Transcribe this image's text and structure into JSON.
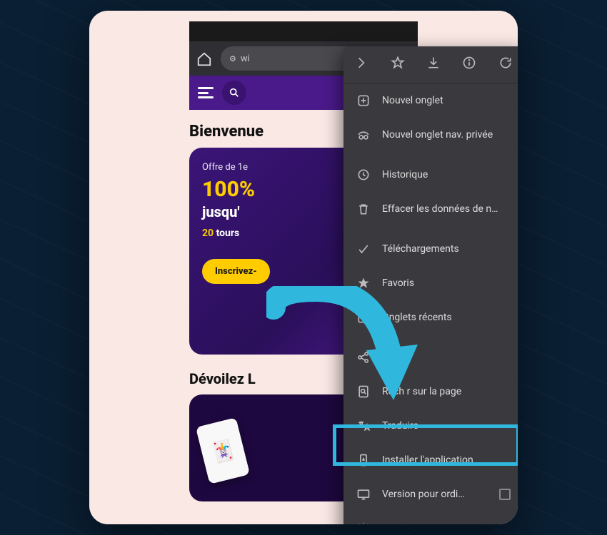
{
  "browser": {
    "url_prefix": "wi"
  },
  "site": {
    "welcome": "Bienvenue",
    "promo": {
      "subtitle": "Offre de 1e",
      "percent": "100%",
      "upto": "jusqu'",
      "spins_num": "20",
      "spins_text": "tours",
      "cta": "Inscrivez-"
    },
    "reveal": "Dévoilez L"
  },
  "menu": {
    "new_tab": "Nouvel onglet",
    "new_private": "Nouvel onglet nav. privée",
    "history": "Historique",
    "clear_data": "Effacer les données de n…",
    "downloads": "Téléchargements",
    "bookmarks": "Favoris",
    "recent_tabs": "Onglets récents",
    "share": "Pa",
    "find": "Rech            r sur la page",
    "translate": "Traduire",
    "install": "Installer l'application",
    "desktop": "Version pour ordi…"
  },
  "colors": {
    "highlight": "#2fb7dd"
  }
}
